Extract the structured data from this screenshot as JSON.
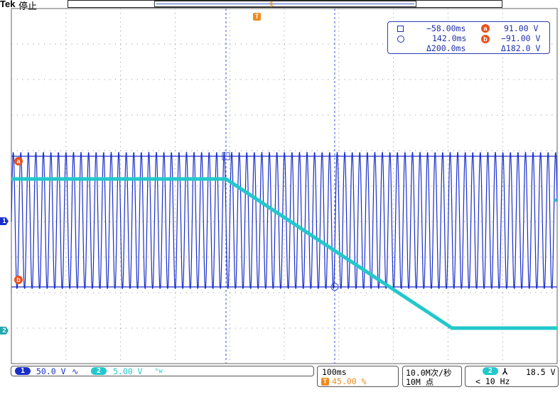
{
  "header": {
    "brand": "Tek",
    "state": "停止"
  },
  "colors": {
    "ch1": "#1a2fc9",
    "ch2": "#22c8cc",
    "marker": "#e8501e",
    "grid": "#8a8a8a",
    "cursor": "#3c56d6"
  },
  "readout": {
    "t1": "−58.00ms",
    "v1_label": "a",
    "v1": "91.00 V",
    "t2": "142.0ms",
    "v2_label": "b",
    "v2": "−91.00 V",
    "dt": "Δ200.0ms",
    "dv": "Δ182.0 V"
  },
  "markers": {
    "a": "a",
    "b": "b",
    "ch1": "1",
    "ch2": "2",
    "trigger": "T"
  },
  "status": {
    "ch1_num": "1",
    "ch1_scale": "50.0 V",
    "ch1_coupling": "∿",
    "ch2_num": "2",
    "ch2_scale": "5.00 V",
    "ch2_bw": "ᵇw",
    "timebase": "100ms",
    "trigger_icon": "T",
    "trigger_pos": "45.00 %",
    "sample_rate": "10.0M次/秒",
    "record_length": "10M 点",
    "trig_source": "2",
    "trig_slope": "⅄",
    "trig_level": "18.5 V",
    "trig_freq": "< 10 Hz"
  }
}
